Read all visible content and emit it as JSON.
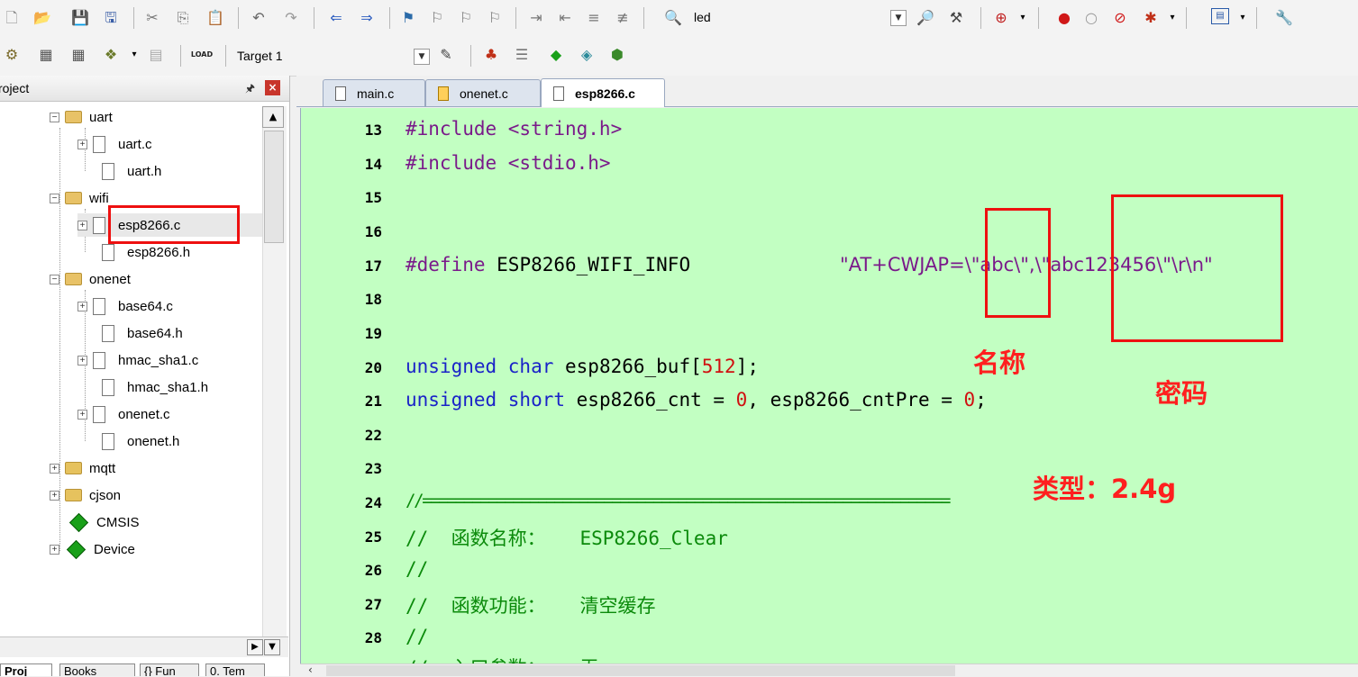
{
  "toolbar1": {
    "target_text": "led",
    "icons": [
      "new-file-icon",
      "open-folder-icon",
      "save-icon",
      "save-all-icon",
      "cut-icon",
      "copy-icon",
      "paste-icon",
      "undo-icon",
      "redo-icon",
      "nav-back-icon",
      "nav-forward-icon",
      "bookmark-icon",
      "prev-bookmark-icon",
      "next-bookmark-icon",
      "clear-bookmarks-icon",
      "indent-icon",
      "unindent-icon",
      "comment-icon",
      "uncomment-icon",
      "find-in-files-icon",
      "dropdown-icon",
      "find-icon",
      "jump-icon",
      "debug-icon",
      "breakpoint-icon",
      "disable-breakpoint-icon",
      "kill-breakpoints-icon",
      "configure-icon",
      "window-icon",
      "wrench-icon"
    ]
  },
  "toolbar2": {
    "target_name": "Target 1",
    "load_label": "LOAD"
  },
  "project_panel": {
    "title": "roject",
    "pin_glyph": "ᵖ",
    "close_glyph": "×",
    "tree": [
      {
        "label": "uart",
        "type": "folder",
        "expander": "-"
      },
      {
        "label": "uart.c",
        "type": "file",
        "expander": "+"
      },
      {
        "label": "uart.h",
        "type": "file",
        "expander": ""
      },
      {
        "label": "wifi",
        "type": "folder",
        "expander": "-"
      },
      {
        "label": "esp8266.c",
        "type": "file",
        "expander": "+"
      },
      {
        "label": "esp8266.h",
        "type": "file",
        "expander": ""
      },
      {
        "label": "onenet",
        "type": "folder",
        "expander": "-"
      },
      {
        "label": "base64.c",
        "type": "file",
        "expander": "+"
      },
      {
        "label": "base64.h",
        "type": "file",
        "expander": ""
      },
      {
        "label": "hmac_sha1.c",
        "type": "file",
        "expander": "+"
      },
      {
        "label": "hmac_sha1.h",
        "type": "file",
        "expander": ""
      },
      {
        "label": "onenet.c",
        "type": "file",
        "expander": "+"
      },
      {
        "label": "onenet.h",
        "type": "file",
        "expander": ""
      },
      {
        "label": "mqtt",
        "type": "folder",
        "expander": "+"
      },
      {
        "label": "cjson",
        "type": "folder",
        "expander": "+"
      },
      {
        "label": "CMSIS",
        "type": "component",
        "expander": ""
      },
      {
        "label": "Device",
        "type": "component",
        "expander": "+"
      }
    ],
    "bottom_tabs": [
      "Proj",
      "Books",
      "{} Fun",
      "0. Tem"
    ]
  },
  "editor_tabs": [
    {
      "label": "main.c",
      "active": false
    },
    {
      "label": "onenet.c",
      "active": false
    },
    {
      "label": "esp8266.c",
      "active": true
    }
  ],
  "code_lines": [
    {
      "n": "13",
      "text": "#include <string.h>"
    },
    {
      "n": "14",
      "text": "#include <stdio.h>"
    },
    {
      "n": "15",
      "text": ""
    },
    {
      "n": "16",
      "text": ""
    },
    {
      "n": "17",
      "define_kw": "#define",
      "macro": " ESP8266_WIFI_INFO",
      "str": "\"AT+CWJAP=\\\"abc\\\",\\\"abc123456\\\"\\r\\n\""
    },
    {
      "n": "18",
      "text": ""
    },
    {
      "n": "19",
      "text": ""
    },
    {
      "n": "20",
      "kw": "unsigned char",
      "mid": " esp8266_buf[",
      "num": "512",
      "end": "];"
    },
    {
      "n": "21",
      "kw": "unsigned short",
      "mid": " esp8266_cnt = ",
      "num": "0",
      "mid2": ", esp8266_cntPre = ",
      "num2": "0",
      "end": ";"
    },
    {
      "n": "22",
      "text": ""
    },
    {
      "n": "23",
      "text": ""
    },
    {
      "n": "24",
      "text": "//================================================================"
    },
    {
      "n": "25",
      "text": "//  函数名称：   ESP8266_Clear"
    },
    {
      "n": "26",
      "text": "//"
    },
    {
      "n": "27",
      "text": "//  函数功能：   清空缓存"
    },
    {
      "n": "28",
      "text": "//"
    },
    {
      "n": "",
      "text": "//  入口参数：   无"
    }
  ],
  "annotations": {
    "name_label": "名称",
    "password_label": "密码",
    "type_label": "类型：2.4g",
    "color": "#ff1f1f"
  },
  "colors": {
    "editor_background": "#c2ffc2",
    "preprocessor": "#7a1a8a",
    "keyword": "#1a22c8",
    "number": "#d01010",
    "comment": "#0b8a0b"
  }
}
